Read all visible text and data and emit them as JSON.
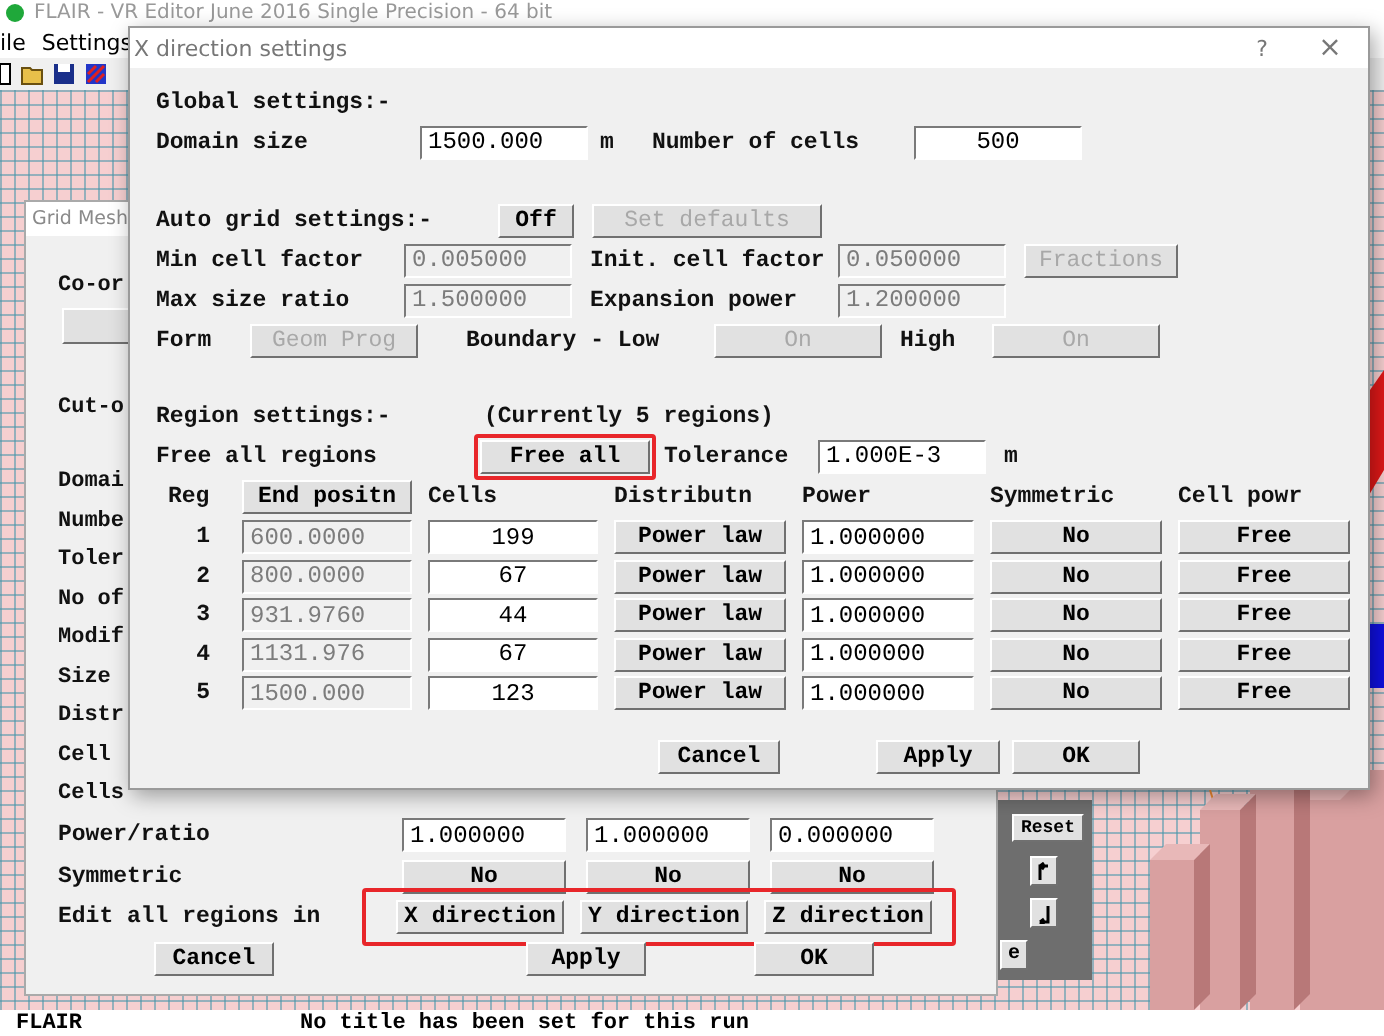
{
  "app": {
    "title": "FLAIR - VR Editor June 2016 Single Precision - 64 bit",
    "menu": [
      {
        "label": "ile"
      },
      {
        "label": "Settings"
      }
    ],
    "status_bar": {
      "program": "FLAIR",
      "run_title": "No title has been set for this run"
    }
  },
  "grid_mesh_dialog": {
    "title": "Grid Mesh",
    "top_labels": [
      "Co-or",
      "Cut-o"
    ],
    "row_labels": [
      "Domai",
      "Numbe",
      "Toler",
      "No of",
      "Modif",
      "Size",
      "Distr",
      "Cell",
      "Cells"
    ],
    "power_ratio": {
      "label": "Power/ratio",
      "values": [
        "1.000000",
        "1.000000",
        "0.000000"
      ]
    },
    "symmetric": {
      "label": "Symmetric",
      "values": [
        "No",
        "No",
        "No"
      ]
    },
    "edit_all_regions": {
      "label": "Edit all regions in",
      "highlighted": true,
      "buttons": [
        "X direction",
        "Y direction",
        "Z direction"
      ]
    },
    "buttons": [
      "Cancel",
      "Apply",
      "OK"
    ]
  },
  "side_panel": {
    "reset": "Reset",
    "clipped_button": "e"
  },
  "x_dialog": {
    "title": "X direction settings",
    "help": "?",
    "close": "×",
    "global": {
      "heading": "Global settings:-",
      "domain_size": {
        "label": "Domain size",
        "value": "1500.000",
        "unit": "m"
      },
      "number_of_cells": {
        "label": "Number of cells",
        "value": "500"
      }
    },
    "auto_grid": {
      "heading": "Auto grid settings:-",
      "toggle": {
        "label": "Off",
        "disabled": false
      },
      "set_defaults": {
        "label": "Set defaults",
        "disabled": true
      },
      "min_cell_factor": {
        "label": "Min cell factor",
        "value": "0.005000",
        "disabled": true
      },
      "init_cell_factor": {
        "label": "Init. cell factor",
        "value": "0.050000",
        "disabled": true
      },
      "fractions": {
        "label": "Fractions",
        "disabled": true
      },
      "max_size_ratio": {
        "label": "Max size ratio",
        "value": "1.500000",
        "disabled": true
      },
      "expansion_power": {
        "label": "Expansion power",
        "value": "1.200000",
        "disabled": true
      },
      "form": {
        "label": "Form",
        "button": {
          "label": "Geom Prog",
          "disabled": true
        }
      },
      "boundary_low": {
        "label": "Boundary - Low",
        "button": {
          "label": "On",
          "disabled": true
        }
      },
      "boundary_high": {
        "label": "High",
        "button": {
          "label": "On",
          "disabled": true
        }
      }
    },
    "regions": {
      "heading": "Region settings:-",
      "count_note": "(Currently 5 regions)",
      "free_all_label": "Free all regions",
      "free_all": {
        "label": "Free all",
        "highlighted": true
      },
      "tolerance": {
        "label": "Tolerance",
        "value": "1.000E-3",
        "unit": "m"
      },
      "columns": [
        {
          "label": "Reg",
          "kind": "text"
        },
        {
          "label": "End positn",
          "kind": "button"
        },
        {
          "label": "Cells",
          "kind": "text"
        },
        {
          "label": "Distributn",
          "kind": "text"
        },
        {
          "label": "Power",
          "kind": "text"
        },
        {
          "label": "Symmetric",
          "kind": "text"
        },
        {
          "label": "Cell powr",
          "kind": "text"
        }
      ],
      "rows": [
        {
          "reg": "1",
          "end": "600.0000",
          "end_disabled": true,
          "cells": "199",
          "distribution": "Power law",
          "power": "1.000000",
          "symmetric": "No",
          "cell_power": "Free"
        },
        {
          "reg": "2",
          "end": "800.0000",
          "end_disabled": true,
          "cells": "67",
          "distribution": "Power law",
          "power": "1.000000",
          "symmetric": "No",
          "cell_power": "Free"
        },
        {
          "reg": "3",
          "end": "931.9760",
          "end_disabled": true,
          "cells": "44",
          "distribution": "Power law",
          "power": "1.000000",
          "symmetric": "No",
          "cell_power": "Free"
        },
        {
          "reg": "4",
          "end": "1131.976",
          "end_disabled": true,
          "cells": "67",
          "distribution": "Power law",
          "power": "1.000000",
          "symmetric": "No",
          "cell_power": "Free"
        },
        {
          "reg": "5",
          "end": "1500.000",
          "end_disabled": true,
          "cells": "123",
          "distribution": "Power law",
          "power": "1.000000",
          "symmetric": "No",
          "cell_power": "Free"
        }
      ]
    },
    "buttons": [
      "Cancel",
      "Apply",
      "OK"
    ]
  }
}
